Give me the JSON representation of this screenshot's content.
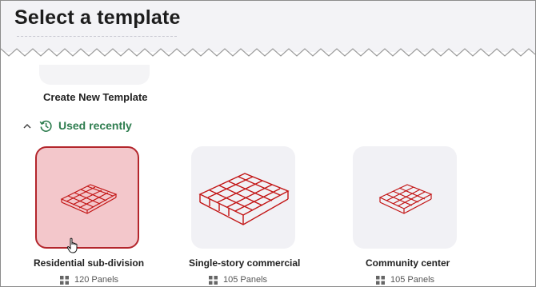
{
  "page": {
    "title": "Select a template"
  },
  "create_card": {
    "label": "Create New Template"
  },
  "section": {
    "title": "Used recently",
    "collapse_icon": "chevron-up-icon",
    "icon": "history-icon"
  },
  "templates": [
    {
      "name": "Residential sub-division",
      "panels": "120 Panels",
      "selected": true
    },
    {
      "name": "Single-story commercial",
      "panels": "105 Panels",
      "selected": false
    },
    {
      "name": "Community center",
      "panels": "105 Panels",
      "selected": false
    }
  ],
  "colors": {
    "accent_green": "#2e7d4f",
    "selected_fill": "#f3c7cb",
    "selected_border": "#b3262c",
    "model_red": "#c21414"
  }
}
